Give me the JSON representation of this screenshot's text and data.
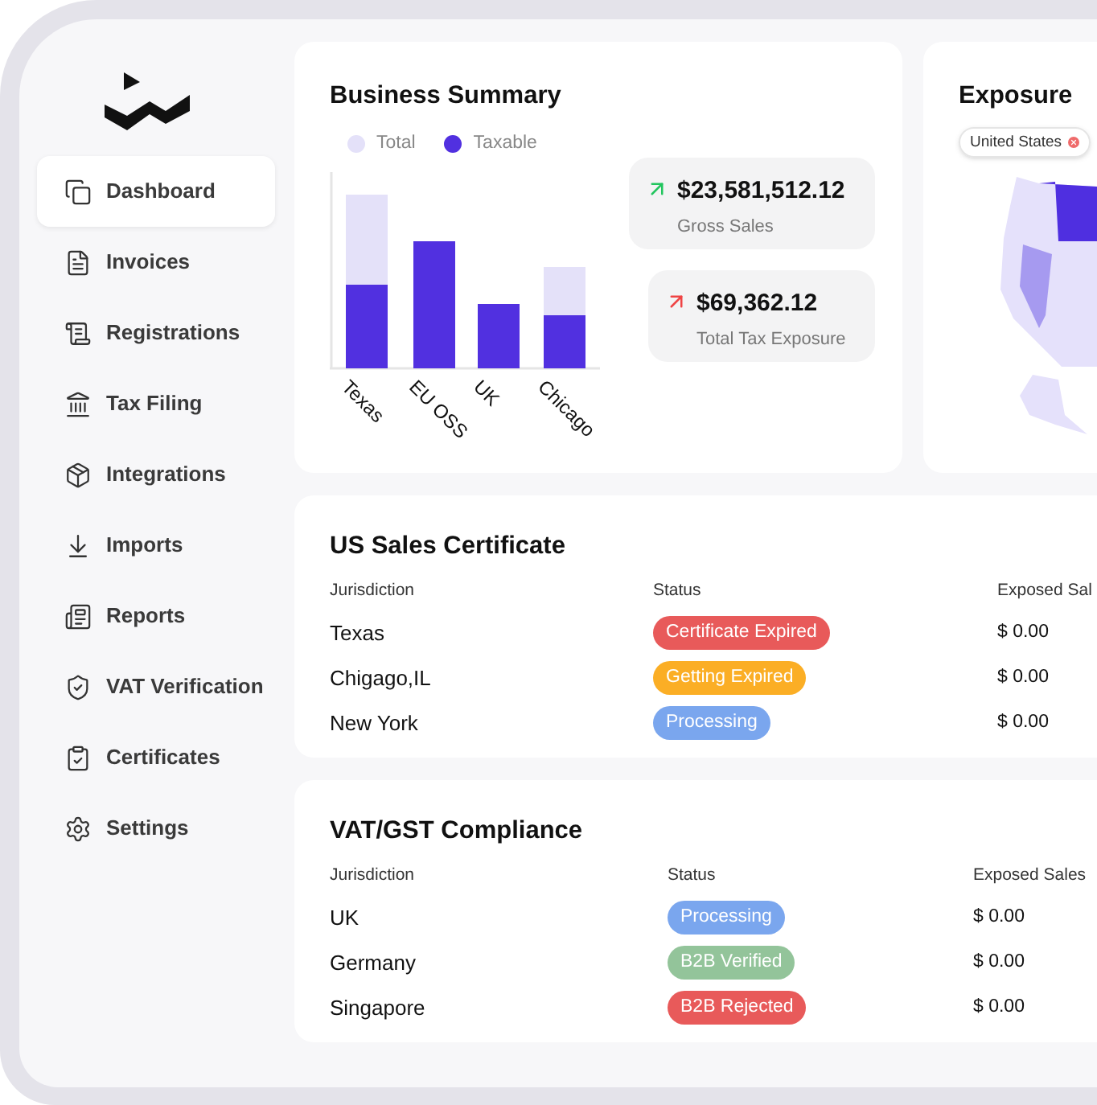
{
  "sidebar": {
    "items": [
      {
        "label": "Dashboard",
        "selected": true
      },
      {
        "label": "Invoices",
        "selected": false
      },
      {
        "label": "Registrations",
        "selected": false
      },
      {
        "label": "Tax Filing",
        "selected": false
      },
      {
        "label": "Integrations",
        "selected": false
      },
      {
        "label": "Imports",
        "selected": false
      },
      {
        "label": "Reports",
        "selected": false
      },
      {
        "label": "VAT Verification",
        "selected": false
      },
      {
        "label": "Certificates",
        "selected": false
      },
      {
        "label": "Settings",
        "selected": false
      }
    ]
  },
  "business_summary": {
    "title": "Business Summary",
    "legend": [
      {
        "label": "Total",
        "color": "#e4e1f9"
      },
      {
        "label": "Taxable",
        "color": "#5130e0"
      }
    ],
    "categories": [
      "Texas",
      "EU OSS",
      "UK",
      "Chicago"
    ],
    "stats": [
      {
        "value": "$23,581,512.12",
        "label": "Gross Sales",
        "color": "#22c55e"
      },
      {
        "value": "$69,362.12",
        "label": "Total Tax Exposure",
        "color": "#ef4444"
      }
    ]
  },
  "exposure": {
    "title": "Exposure",
    "filter": "United States"
  },
  "tables": [
    {
      "title": "US Sales Certificate",
      "columns": [
        "Jurisdiction",
        "Status",
        "Exposed Sal"
      ],
      "rows": [
        {
          "jurisdiction": "Texas",
          "status": {
            "label": "Certificate Expired",
            "color": "#e85a5a"
          },
          "exposed_sales": "$ 0.00"
        },
        {
          "jurisdiction": "Chigago,IL",
          "status": {
            "label": "Getting Expired",
            "color": "#fbae25"
          },
          "exposed_sales": "$ 0.00"
        },
        {
          "jurisdiction": "New York",
          "status": {
            "label": "Processing",
            "color": "#7aa6ee"
          },
          "exposed_sales": "$ 0.00"
        }
      ]
    },
    {
      "title": "VAT/GST Compliance",
      "columns": [
        "Jurisdiction",
        "Status",
        "Exposed Sales"
      ],
      "rows": [
        {
          "jurisdiction": "UK",
          "status": {
            "label": "Processing",
            "color": "#7aa6ee"
          },
          "exposed_sales": "$ 0.00"
        },
        {
          "jurisdiction": "Germany",
          "status": {
            "label": "B2B Verified",
            "color": "#93c49a"
          },
          "exposed_sales": "$ 0.00"
        },
        {
          "jurisdiction": "Singapore",
          "status": {
            "label": "B2B Rejected",
            "color": "#e85a5a"
          },
          "exposed_sales": "$ 0.00"
        }
      ]
    }
  ]
}
